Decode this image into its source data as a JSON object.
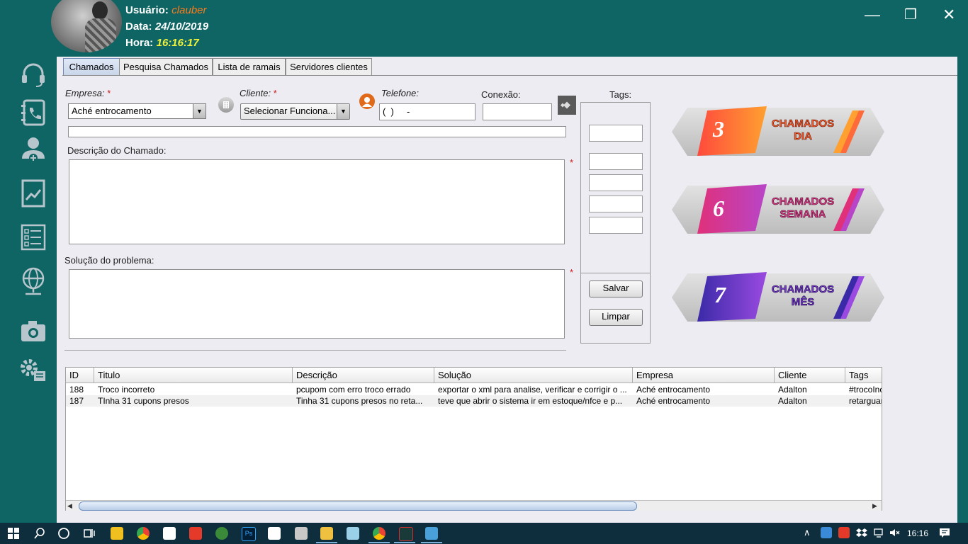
{
  "header": {
    "user_label": "Usuário:",
    "user_value": "clauber",
    "date_label": "Data:",
    "date_value": "24/10/2019",
    "time_label": "Hora:",
    "time_value": "16:16:17",
    "colors": {
      "user": "#ff7a1a",
      "date": "#ffffff",
      "time": "#f2f23a"
    }
  },
  "window_controls": {
    "minimize": "—",
    "maximize": "❐",
    "close": "✕"
  },
  "sidebar": {
    "items": [
      {
        "icon": "headset-icon"
      },
      {
        "icon": "phone-book-icon"
      },
      {
        "icon": "add-user-icon"
      },
      {
        "icon": "report-chart-icon"
      },
      {
        "icon": "checklist-icon"
      },
      {
        "icon": "network-globe-icon"
      },
      {
        "icon": "camera-icon"
      },
      {
        "icon": "settings-list-icon"
      }
    ]
  },
  "tabs": [
    {
      "label": "Chamados",
      "active": true
    },
    {
      "label": "Pesquisa Chamados",
      "active": false
    },
    {
      "label": "Lista de ramais",
      "active": false
    },
    {
      "label": "Servidores clientes",
      "active": false
    }
  ],
  "form": {
    "empresa_label": "Empresa:",
    "empresa_value": "Aché entrocamento",
    "cliente_label": "Cliente:",
    "cliente_value": "Selecionar Funciona...",
    "telefone_label": "Telefone:",
    "telefone_value": "(  )     -",
    "conexao_label": "Conexão:",
    "conexao_value": "",
    "tags_label": "Tags:",
    "required_mark": "*",
    "descricao_label": "Descrição do Chamado:",
    "solucao_label": "Solução do problema:",
    "salvar_label": "Salvar",
    "limpar_label": "Limpar"
  },
  "badges": [
    {
      "number": "3",
      "line1": "CHAMADOS",
      "line2": "DIA",
      "color_from": "#ff4a3d",
      "color_to": "#ffa030",
      "text_color": "#ff5a2a"
    },
    {
      "number": "6",
      "line1": "CHAMADOS",
      "line2": "SEMANA",
      "color_from": "#e0307a",
      "color_to": "#b845c8",
      "text_color": "#e03a8a"
    },
    {
      "number": "7",
      "line1": "CHAMADOS",
      "line2": "MÊS",
      "color_from": "#3a2aa8",
      "color_to": "#9a4ae0",
      "text_color": "#7a3ac8"
    }
  ],
  "table": {
    "columns": [
      "ID",
      "Titulo",
      "Descrição",
      "Solução",
      "Empresa",
      "Cliente",
      "Tags"
    ],
    "rows": [
      [
        "188",
        "Troco incorreto",
        "pcupom com erro troco errado",
        "exportar o xml para analise, verificar e corrigir o ...",
        "Aché entrocamento",
        "Adalton",
        "#trocoIncorreto"
      ],
      [
        "187",
        "TInha 31 cupons presos",
        "Tinha 31 cupons presos no reta...",
        "teve que abrir o sistema ir em estoque/nfce e p...",
        "Aché entrocamento",
        "Adalton",
        "retarguarda"
      ]
    ]
  },
  "taskbar": {
    "clock": "16:16",
    "apps": [
      "windows-start-icon",
      "search-icon",
      "cortana-icon",
      "task-view-icon",
      "app-hand-icon",
      "chrome-icon",
      "store-icon",
      "anydesk-icon",
      "app-green-icon",
      "photoshop-icon",
      "mail-icon",
      "calculator-icon",
      "file-explorer-icon",
      "notepad-icon",
      "chrome-icon-2",
      "java-app-icon",
      "app-active-icon"
    ],
    "tray": [
      "chevron-up-icon",
      "network-app-icon",
      "anydesk-tray-icon",
      "dropbox-icon",
      "network-icon",
      "volume-mute-icon",
      "notification-icon"
    ]
  }
}
